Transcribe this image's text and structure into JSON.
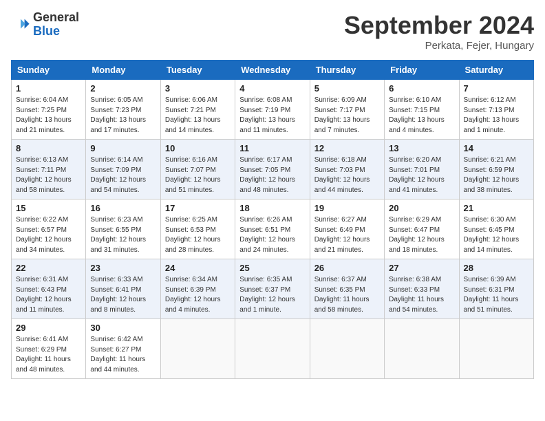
{
  "header": {
    "logo_general": "General",
    "logo_blue": "Blue",
    "month_title": "September 2024",
    "location": "Perkata, Fejer, Hungary"
  },
  "weekdays": [
    "Sunday",
    "Monday",
    "Tuesday",
    "Wednesday",
    "Thursday",
    "Friday",
    "Saturday"
  ],
  "weeks": [
    [
      {
        "day": "1",
        "info": "Sunrise: 6:04 AM\nSunset: 7:25 PM\nDaylight: 13 hours\nand 21 minutes."
      },
      {
        "day": "2",
        "info": "Sunrise: 6:05 AM\nSunset: 7:23 PM\nDaylight: 13 hours\nand 17 minutes."
      },
      {
        "day": "3",
        "info": "Sunrise: 6:06 AM\nSunset: 7:21 PM\nDaylight: 13 hours\nand 14 minutes."
      },
      {
        "day": "4",
        "info": "Sunrise: 6:08 AM\nSunset: 7:19 PM\nDaylight: 13 hours\nand 11 minutes."
      },
      {
        "day": "5",
        "info": "Sunrise: 6:09 AM\nSunset: 7:17 PM\nDaylight: 13 hours\nand 7 minutes."
      },
      {
        "day": "6",
        "info": "Sunrise: 6:10 AM\nSunset: 7:15 PM\nDaylight: 13 hours\nand 4 minutes."
      },
      {
        "day": "7",
        "info": "Sunrise: 6:12 AM\nSunset: 7:13 PM\nDaylight: 13 hours\nand 1 minute."
      }
    ],
    [
      {
        "day": "8",
        "info": "Sunrise: 6:13 AM\nSunset: 7:11 PM\nDaylight: 12 hours\nand 58 minutes."
      },
      {
        "day": "9",
        "info": "Sunrise: 6:14 AM\nSunset: 7:09 PM\nDaylight: 12 hours\nand 54 minutes."
      },
      {
        "day": "10",
        "info": "Sunrise: 6:16 AM\nSunset: 7:07 PM\nDaylight: 12 hours\nand 51 minutes."
      },
      {
        "day": "11",
        "info": "Sunrise: 6:17 AM\nSunset: 7:05 PM\nDaylight: 12 hours\nand 48 minutes."
      },
      {
        "day": "12",
        "info": "Sunrise: 6:18 AM\nSunset: 7:03 PM\nDaylight: 12 hours\nand 44 minutes."
      },
      {
        "day": "13",
        "info": "Sunrise: 6:20 AM\nSunset: 7:01 PM\nDaylight: 12 hours\nand 41 minutes."
      },
      {
        "day": "14",
        "info": "Sunrise: 6:21 AM\nSunset: 6:59 PM\nDaylight: 12 hours\nand 38 minutes."
      }
    ],
    [
      {
        "day": "15",
        "info": "Sunrise: 6:22 AM\nSunset: 6:57 PM\nDaylight: 12 hours\nand 34 minutes."
      },
      {
        "day": "16",
        "info": "Sunrise: 6:23 AM\nSunset: 6:55 PM\nDaylight: 12 hours\nand 31 minutes."
      },
      {
        "day": "17",
        "info": "Sunrise: 6:25 AM\nSunset: 6:53 PM\nDaylight: 12 hours\nand 28 minutes."
      },
      {
        "day": "18",
        "info": "Sunrise: 6:26 AM\nSunset: 6:51 PM\nDaylight: 12 hours\nand 24 minutes."
      },
      {
        "day": "19",
        "info": "Sunrise: 6:27 AM\nSunset: 6:49 PM\nDaylight: 12 hours\nand 21 minutes."
      },
      {
        "day": "20",
        "info": "Sunrise: 6:29 AM\nSunset: 6:47 PM\nDaylight: 12 hours\nand 18 minutes."
      },
      {
        "day": "21",
        "info": "Sunrise: 6:30 AM\nSunset: 6:45 PM\nDaylight: 12 hours\nand 14 minutes."
      }
    ],
    [
      {
        "day": "22",
        "info": "Sunrise: 6:31 AM\nSunset: 6:43 PM\nDaylight: 12 hours\nand 11 minutes."
      },
      {
        "day": "23",
        "info": "Sunrise: 6:33 AM\nSunset: 6:41 PM\nDaylight: 12 hours\nand 8 minutes."
      },
      {
        "day": "24",
        "info": "Sunrise: 6:34 AM\nSunset: 6:39 PM\nDaylight: 12 hours\nand 4 minutes."
      },
      {
        "day": "25",
        "info": "Sunrise: 6:35 AM\nSunset: 6:37 PM\nDaylight: 12 hours\nand 1 minute."
      },
      {
        "day": "26",
        "info": "Sunrise: 6:37 AM\nSunset: 6:35 PM\nDaylight: 11 hours\nand 58 minutes."
      },
      {
        "day": "27",
        "info": "Sunrise: 6:38 AM\nSunset: 6:33 PM\nDaylight: 11 hours\nand 54 minutes."
      },
      {
        "day": "28",
        "info": "Sunrise: 6:39 AM\nSunset: 6:31 PM\nDaylight: 11 hours\nand 51 minutes."
      }
    ],
    [
      {
        "day": "29",
        "info": "Sunrise: 6:41 AM\nSunset: 6:29 PM\nDaylight: 11 hours\nand 48 minutes."
      },
      {
        "day": "30",
        "info": "Sunrise: 6:42 AM\nSunset: 6:27 PM\nDaylight: 11 hours\nand 44 minutes."
      },
      {
        "day": "",
        "info": ""
      },
      {
        "day": "",
        "info": ""
      },
      {
        "day": "",
        "info": ""
      },
      {
        "day": "",
        "info": ""
      },
      {
        "day": "",
        "info": ""
      }
    ]
  ]
}
